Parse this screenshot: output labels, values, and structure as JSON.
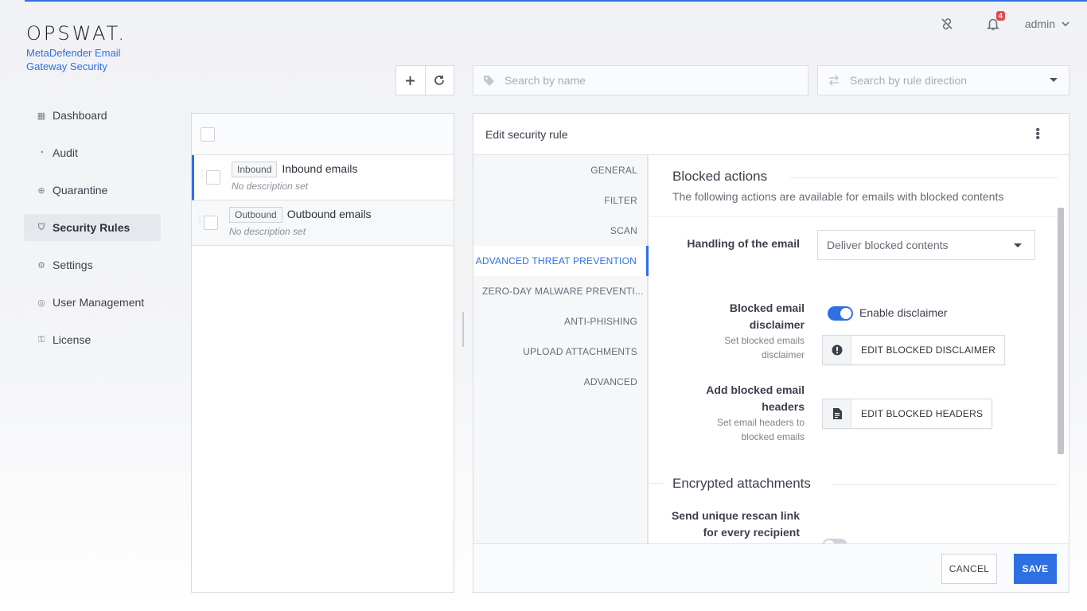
{
  "brand": {
    "logo": "OPSWAT.",
    "product": "MetaDefender Email Gateway Security"
  },
  "header": {
    "notification_count": "4",
    "user": "admin"
  },
  "nav": {
    "items": [
      {
        "label": "Dashboard",
        "icon": "grid-icon"
      },
      {
        "label": "Audit",
        "icon": "audit-icon"
      },
      {
        "label": "Quarantine",
        "icon": "quarantine-icon"
      },
      {
        "label": "Security Rules",
        "icon": "shield-icon",
        "active": true
      },
      {
        "label": "Settings",
        "icon": "gear-icon"
      },
      {
        "label": "User Management",
        "icon": "user-icon"
      },
      {
        "label": "License",
        "icon": "key-icon"
      }
    ]
  },
  "search": {
    "name_placeholder": "Search by name",
    "direction_placeholder": "Search by rule direction"
  },
  "rules": [
    {
      "tag": "Inbound",
      "name": "Inbound emails",
      "desc": "No description set",
      "selected": true
    },
    {
      "tag": "Outbound",
      "name": "Outbound emails",
      "desc": "No description set",
      "selected": false
    }
  ],
  "edit": {
    "title": "Edit security rule",
    "tabs": [
      "GENERAL",
      "FILTER",
      "SCAN",
      "ADVANCED THREAT PREVENTION",
      "ZERO-DAY MALWARE PREVENTI...",
      "ANTI-PHISHING",
      "UPLOAD ATTACHMENTS",
      "ADVANCED"
    ],
    "active_tab": 3,
    "blocked": {
      "title": "Blocked actions",
      "subtitle": "The following actions are available for emails with blocked contents",
      "handling_label": "Handling of the email",
      "handling_value": "Deliver blocked contents",
      "disclaimer_label": "Blocked email disclaimer",
      "disclaimer_sub": "Set blocked emails disclaimer",
      "disclaimer_toggle_label": "Enable disclaimer",
      "disclaimer_button": "EDIT BLOCKED DISCLAIMER",
      "headers_label": "Add blocked email headers",
      "headers_sub": "Set email headers to blocked emails",
      "headers_button": "EDIT BLOCKED HEADERS"
    },
    "encrypted": {
      "title": "Encrypted attachments",
      "rescan_label": "Send unique rescan link for every recipient"
    },
    "cancel": "CANCEL",
    "save": "SAVE"
  }
}
